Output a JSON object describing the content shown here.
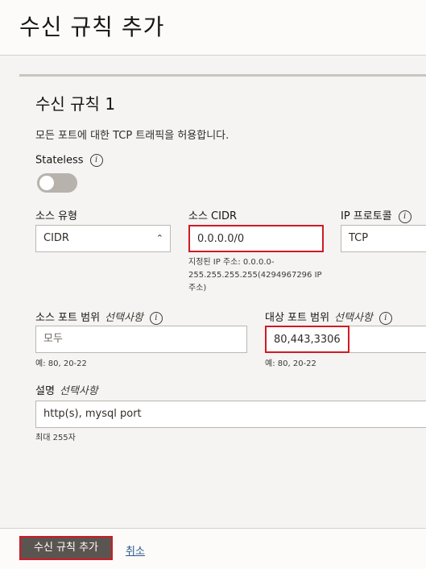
{
  "header": {
    "title": "수신 규칙 추가"
  },
  "rule": {
    "title": "수신 규칙 1",
    "description": "모든 포트에 대한 TCP 트래픽을 허용합니다.",
    "stateless_label": "Stateless",
    "stateless_on": false,
    "source_type": {
      "label": "소스 유형",
      "value": "CIDR"
    },
    "source_cidr": {
      "label": "소스 CIDR",
      "value": "0.0.0.0/0",
      "help_line1": "지정된 IP 주소: 0.0.0.0-",
      "help_line2": "255.255.255.255(4294967296 IP",
      "help_line3": "주소)"
    },
    "ip_protocol": {
      "label": "IP 프로토콜",
      "value": "TCP"
    },
    "source_port": {
      "label": "소스 포트 범위",
      "optional": "선택사항",
      "placeholder": "모두",
      "help": "예: 80, 20-22"
    },
    "dest_port": {
      "label": "대상 포트 범위",
      "optional": "선택사항",
      "value": "80,443,3306",
      "help": "예: 80, 20-22"
    },
    "description_field": {
      "label": "설명",
      "optional": "선택사항",
      "value": "http(s), mysql port",
      "help": "최대 255자"
    }
  },
  "footer": {
    "add_label": "수신 규칙 추가",
    "cancel_label": "취소"
  },
  "colors": {
    "highlight": "#d01a25",
    "button": "#5b5551",
    "link": "#2b5a8c"
  }
}
